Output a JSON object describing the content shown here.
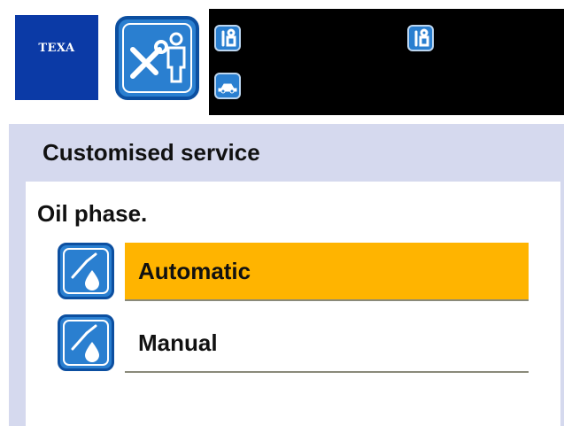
{
  "brand": {
    "logo_text": "TEXA"
  },
  "header": {
    "mode_icon": "wrench-screwdriver-mechanic-icon",
    "small_icons": [
      "tools-mechanic-icon",
      "car-icon",
      "tools-mechanic-icon"
    ]
  },
  "page": {
    "title": "Customised service",
    "prompt": "Oil phase."
  },
  "options": [
    {
      "label": "Automatic",
      "icon": "oil-dropper-icon",
      "selected": true
    },
    {
      "label": "Manual",
      "icon": "oil-dropper-icon",
      "selected": false
    }
  ],
  "colors": {
    "brand_blue": "#0b3aa6",
    "icon_blue": "#2a7fd0",
    "selected": "#ffb400",
    "band": "#d5d9ee",
    "topbar": "#000000"
  }
}
